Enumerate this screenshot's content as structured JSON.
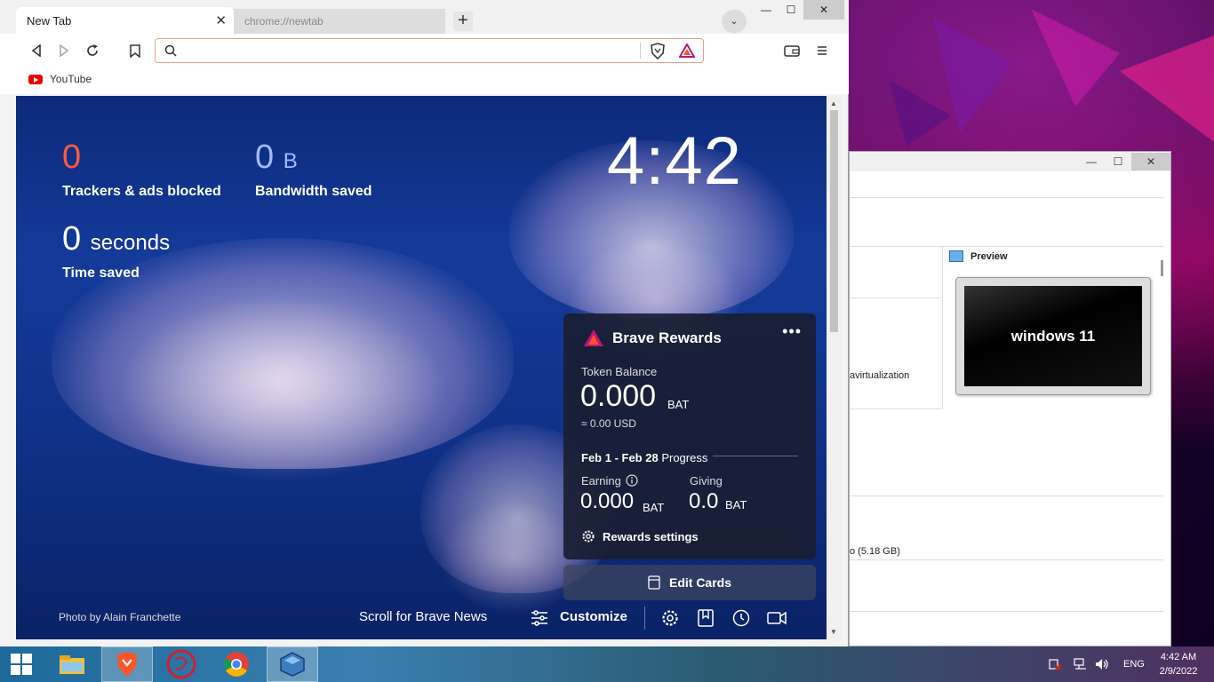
{
  "browser": {
    "tabs": [
      {
        "label": "New Tab",
        "active": true
      },
      {
        "label": "chrome://newtab",
        "active": false
      }
    ],
    "new_tab_symbol": "+",
    "address_placeholder": "",
    "bookmarks": [
      {
        "label": "YouTube",
        "icon": "youtube-icon"
      }
    ]
  },
  "ntp": {
    "trackers_value": "0",
    "trackers_label": "Trackers & ads blocked",
    "bandwidth_value": "0",
    "bandwidth_unit": "B",
    "bandwidth_label": "Bandwidth saved",
    "time_value": "0",
    "time_unit": "seconds",
    "time_label": "Time saved",
    "clock": "4:42",
    "photo_credit_prefix": "Photo by",
    "photo_credit_name": "Alain Franchette",
    "scroll_news": "Scroll for Brave News",
    "customize": "Customize",
    "edit_cards": "Edit Cards"
  },
  "rewards": {
    "title": "Brave Rewards",
    "more": "•••",
    "token_balance_label": "Token Balance",
    "token_balance": "0.000",
    "unit": "BAT",
    "usd": "≈ 0.00 USD",
    "period": "Feb 1 - Feb 28",
    "progress_label": "Progress",
    "earning_label": "Earning",
    "earning_value": "0.000",
    "giving_label": "Giving",
    "giving_value": "0.0",
    "settings": "Rewards settings"
  },
  "vbox": {
    "preview_label": "Preview",
    "vm_name": "windows 11",
    "virtualization_text": "avirtualization",
    "disk_text": "o (5.18 GB)"
  },
  "taskbar": {
    "language": "ENG",
    "time": "4:42 AM",
    "date": "2/9/2022"
  },
  "colors": {
    "trackers_accent": "#ff5a3c",
    "bandwidth_accent": "#a3b8ff",
    "brave_orange": "#fb542b"
  }
}
